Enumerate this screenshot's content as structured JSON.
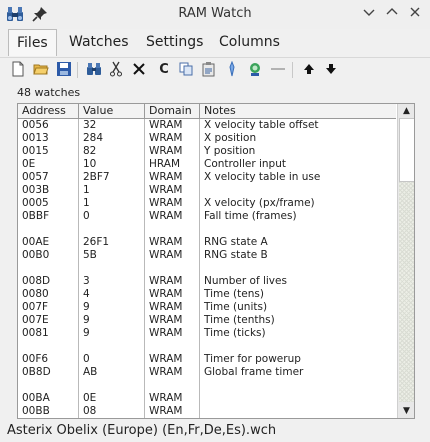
{
  "window": {
    "title": "RAM Watch"
  },
  "menu": {
    "items": [
      "Files",
      "Watches",
      "Settings",
      "Columns"
    ]
  },
  "watch_count": "48 watches",
  "table": {
    "columns": [
      "Address",
      "Value",
      "Domain",
      "Notes"
    ],
    "rows": [
      [
        "0056",
        "32",
        "WRAM",
        "X velocity table offset"
      ],
      [
        "0013",
        "284",
        "WRAM",
        "X position"
      ],
      [
        "0015",
        "82",
        "WRAM",
        "Y position"
      ],
      [
        "0E",
        "10",
        "HRAM",
        "Controller input"
      ],
      [
        "0057",
        "2BF7",
        "WRAM",
        "X velocity table in use"
      ],
      [
        "003B",
        "1",
        "WRAM",
        ""
      ],
      [
        "0005",
        "1",
        "WRAM",
        "X velocity (px/frame)"
      ],
      [
        "0BBF",
        "0",
        "WRAM",
        "Fall time (frames)"
      ],
      [
        "",
        "",
        "",
        ""
      ],
      [
        "00AE",
        "26F1",
        "WRAM",
        "RNG state A"
      ],
      [
        "00B0",
        "5B",
        "WRAM",
        "RNG state B"
      ],
      [
        "",
        "",
        "",
        ""
      ],
      [
        "008D",
        "3",
        "WRAM",
        "Number of lives"
      ],
      [
        "0080",
        "4",
        "WRAM",
        "Time (tens)"
      ],
      [
        "007F",
        "9",
        "WRAM",
        "Time (units)"
      ],
      [
        "007E",
        "9",
        "WRAM",
        "Time (tenths)"
      ],
      [
        "0081",
        "9",
        "WRAM",
        "Time (ticks)"
      ],
      [
        "",
        "",
        "",
        ""
      ],
      [
        "00F6",
        "0",
        "WRAM",
        "Timer for powerup"
      ],
      [
        "0B8D",
        "AB",
        "WRAM",
        "Global frame timer"
      ],
      [
        "",
        "",
        "",
        ""
      ],
      [
        "00BA",
        "0E",
        "WRAM",
        ""
      ],
      [
        "00BB",
        "08",
        "WRAM",
        ""
      ]
    ]
  },
  "status": {
    "file": "Asterix  Obelix (Europe) (En,Fr,De,Es).wch"
  },
  "icons": {
    "app": "binoculars-icon",
    "pin": "pin-icon",
    "toolbar": [
      "new-file-icon",
      "open-folder-icon",
      "save-icon",
      "find-icon",
      "cut-icon",
      "remove-icon",
      "copy-icon",
      "paste-icon",
      "edit-icon",
      "poke-icon",
      "freeze-icon",
      "separator-icon",
      "move-up-icon",
      "move-down-icon"
    ]
  }
}
